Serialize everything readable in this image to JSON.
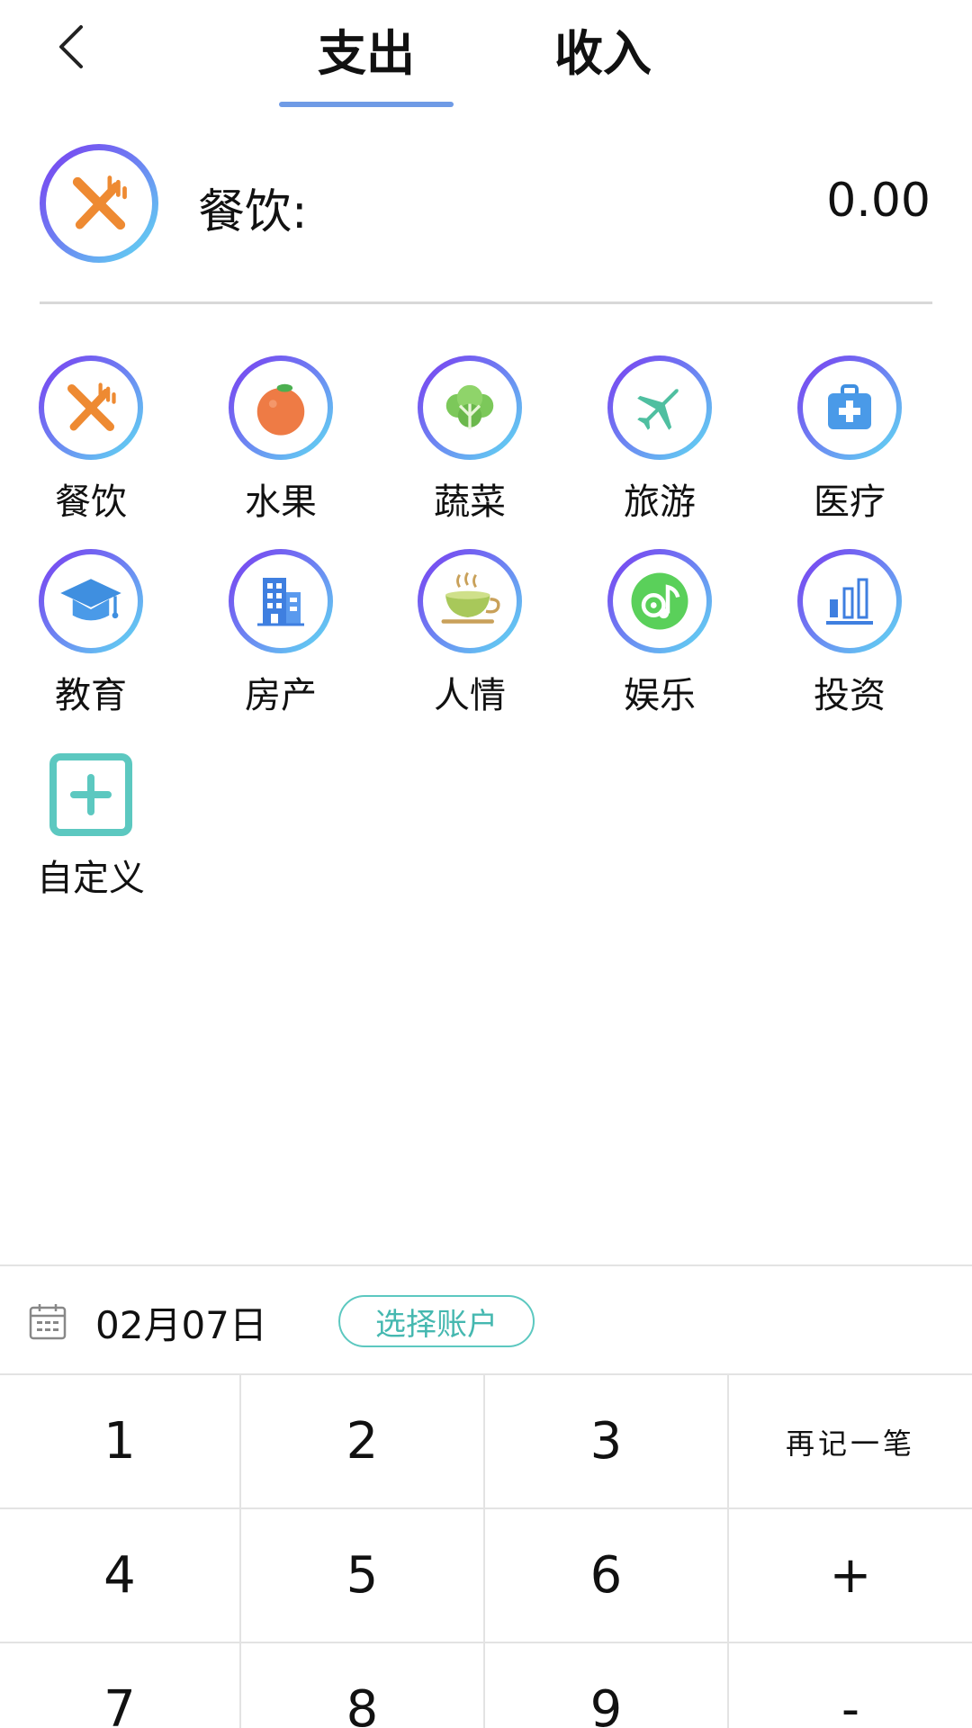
{
  "header": {
    "back_icon": "chevron-left-icon",
    "tabs": [
      {
        "label": "支出",
        "active": true
      },
      {
        "label": "收入",
        "active": false
      }
    ],
    "accent_color": "#6f9be6"
  },
  "selected": {
    "icon": "fork-knife-icon",
    "label": "餐饮:",
    "amount": "0.00"
  },
  "categories": [
    {
      "label": "餐饮",
      "icon": "fork-knife-icon"
    },
    {
      "label": "水果",
      "icon": "orange-icon"
    },
    {
      "label": "蔬菜",
      "icon": "vegetable-icon"
    },
    {
      "label": "旅游",
      "icon": "airplane-icon"
    },
    {
      "label": "医疗",
      "icon": "medical-kit-icon"
    },
    {
      "label": "教育",
      "icon": "graduation-cap-icon"
    },
    {
      "label": "房产",
      "icon": "building-icon"
    },
    {
      "label": "人情",
      "icon": "tea-cup-icon"
    },
    {
      "label": "娱乐",
      "icon": "music-disc-icon"
    },
    {
      "label": "投资",
      "icon": "bar-chart-icon"
    },
    {
      "label": "自定义",
      "icon": "add-box-icon"
    }
  ],
  "bottom": {
    "date": "02月07日",
    "account_button": "选择账户",
    "calendar_icon": "calendar-icon"
  },
  "keypad": {
    "keys": [
      "1",
      "2",
      "3",
      "再记一笔",
      "4",
      "5",
      "6",
      "+",
      "7",
      "8",
      "9",
      "-"
    ]
  }
}
